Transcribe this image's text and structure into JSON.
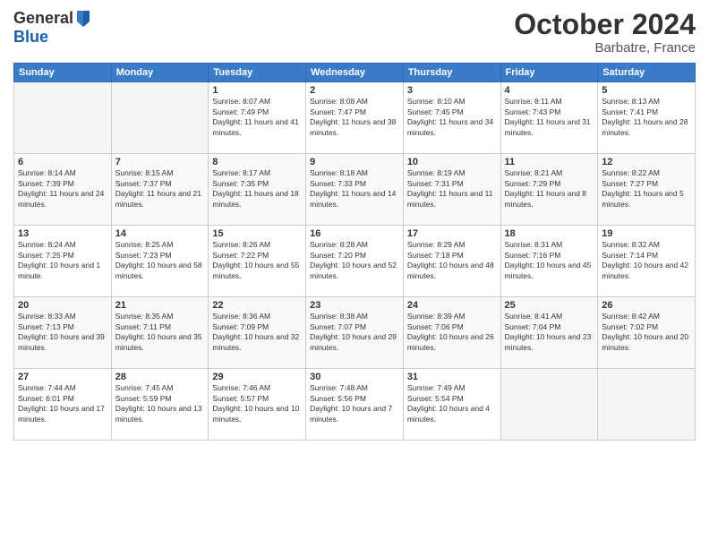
{
  "header": {
    "logo_general": "General",
    "logo_blue": "Blue",
    "month": "October 2024",
    "location": "Barbatre, France"
  },
  "weekdays": [
    "Sunday",
    "Monday",
    "Tuesday",
    "Wednesday",
    "Thursday",
    "Friday",
    "Saturday"
  ],
  "weeks": [
    [
      {
        "day": "",
        "empty": true
      },
      {
        "day": "",
        "empty": true
      },
      {
        "day": "1",
        "sunrise": "8:07 AM",
        "sunset": "7:49 PM",
        "daylight": "11 hours and 41 minutes."
      },
      {
        "day": "2",
        "sunrise": "8:08 AM",
        "sunset": "7:47 PM",
        "daylight": "11 hours and 38 minutes."
      },
      {
        "day": "3",
        "sunrise": "8:10 AM",
        "sunset": "7:45 PM",
        "daylight": "11 hours and 34 minutes."
      },
      {
        "day": "4",
        "sunrise": "8:11 AM",
        "sunset": "7:43 PM",
        "daylight": "11 hours and 31 minutes."
      },
      {
        "day": "5",
        "sunrise": "8:13 AM",
        "sunset": "7:41 PM",
        "daylight": "11 hours and 28 minutes."
      }
    ],
    [
      {
        "day": "6",
        "sunrise": "8:14 AM",
        "sunset": "7:39 PM",
        "daylight": "11 hours and 24 minutes."
      },
      {
        "day": "7",
        "sunrise": "8:15 AM",
        "sunset": "7:37 PM",
        "daylight": "11 hours and 21 minutes."
      },
      {
        "day": "8",
        "sunrise": "8:17 AM",
        "sunset": "7:35 PM",
        "daylight": "11 hours and 18 minutes."
      },
      {
        "day": "9",
        "sunrise": "8:18 AM",
        "sunset": "7:33 PM",
        "daylight": "11 hours and 14 minutes."
      },
      {
        "day": "10",
        "sunrise": "8:19 AM",
        "sunset": "7:31 PM",
        "daylight": "11 hours and 11 minutes."
      },
      {
        "day": "11",
        "sunrise": "8:21 AM",
        "sunset": "7:29 PM",
        "daylight": "11 hours and 8 minutes."
      },
      {
        "day": "12",
        "sunrise": "8:22 AM",
        "sunset": "7:27 PM",
        "daylight": "11 hours and 5 minutes."
      }
    ],
    [
      {
        "day": "13",
        "sunrise": "8:24 AM",
        "sunset": "7:25 PM",
        "daylight": "10 hours and 1 minute."
      },
      {
        "day": "14",
        "sunrise": "8:25 AM",
        "sunset": "7:23 PM",
        "daylight": "10 hours and 58 minutes."
      },
      {
        "day": "15",
        "sunrise": "8:26 AM",
        "sunset": "7:22 PM",
        "daylight": "10 hours and 55 minutes."
      },
      {
        "day": "16",
        "sunrise": "8:28 AM",
        "sunset": "7:20 PM",
        "daylight": "10 hours and 52 minutes."
      },
      {
        "day": "17",
        "sunrise": "8:29 AM",
        "sunset": "7:18 PM",
        "daylight": "10 hours and 48 minutes."
      },
      {
        "day": "18",
        "sunrise": "8:31 AM",
        "sunset": "7:16 PM",
        "daylight": "10 hours and 45 minutes."
      },
      {
        "day": "19",
        "sunrise": "8:32 AM",
        "sunset": "7:14 PM",
        "daylight": "10 hours and 42 minutes."
      }
    ],
    [
      {
        "day": "20",
        "sunrise": "8:33 AM",
        "sunset": "7:13 PM",
        "daylight": "10 hours and 39 minutes."
      },
      {
        "day": "21",
        "sunrise": "8:35 AM",
        "sunset": "7:11 PM",
        "daylight": "10 hours and 35 minutes."
      },
      {
        "day": "22",
        "sunrise": "8:36 AM",
        "sunset": "7:09 PM",
        "daylight": "10 hours and 32 minutes."
      },
      {
        "day": "23",
        "sunrise": "8:38 AM",
        "sunset": "7:07 PM",
        "daylight": "10 hours and 29 minutes."
      },
      {
        "day": "24",
        "sunrise": "8:39 AM",
        "sunset": "7:06 PM",
        "daylight": "10 hours and 26 minutes."
      },
      {
        "day": "25",
        "sunrise": "8:41 AM",
        "sunset": "7:04 PM",
        "daylight": "10 hours and 23 minutes."
      },
      {
        "day": "26",
        "sunrise": "8:42 AM",
        "sunset": "7:02 PM",
        "daylight": "10 hours and 20 minutes."
      }
    ],
    [
      {
        "day": "27",
        "sunrise": "7:44 AM",
        "sunset": "6:01 PM",
        "daylight": "10 hours and 17 minutes."
      },
      {
        "day": "28",
        "sunrise": "7:45 AM",
        "sunset": "5:59 PM",
        "daylight": "10 hours and 13 minutes."
      },
      {
        "day": "29",
        "sunrise": "7:46 AM",
        "sunset": "5:57 PM",
        "daylight": "10 hours and 10 minutes."
      },
      {
        "day": "30",
        "sunrise": "7:48 AM",
        "sunset": "5:56 PM",
        "daylight": "10 hours and 7 minutes."
      },
      {
        "day": "31",
        "sunrise": "7:49 AM",
        "sunset": "5:54 PM",
        "daylight": "10 hours and 4 minutes."
      },
      {
        "day": "",
        "empty": true
      },
      {
        "day": "",
        "empty": true
      }
    ]
  ]
}
